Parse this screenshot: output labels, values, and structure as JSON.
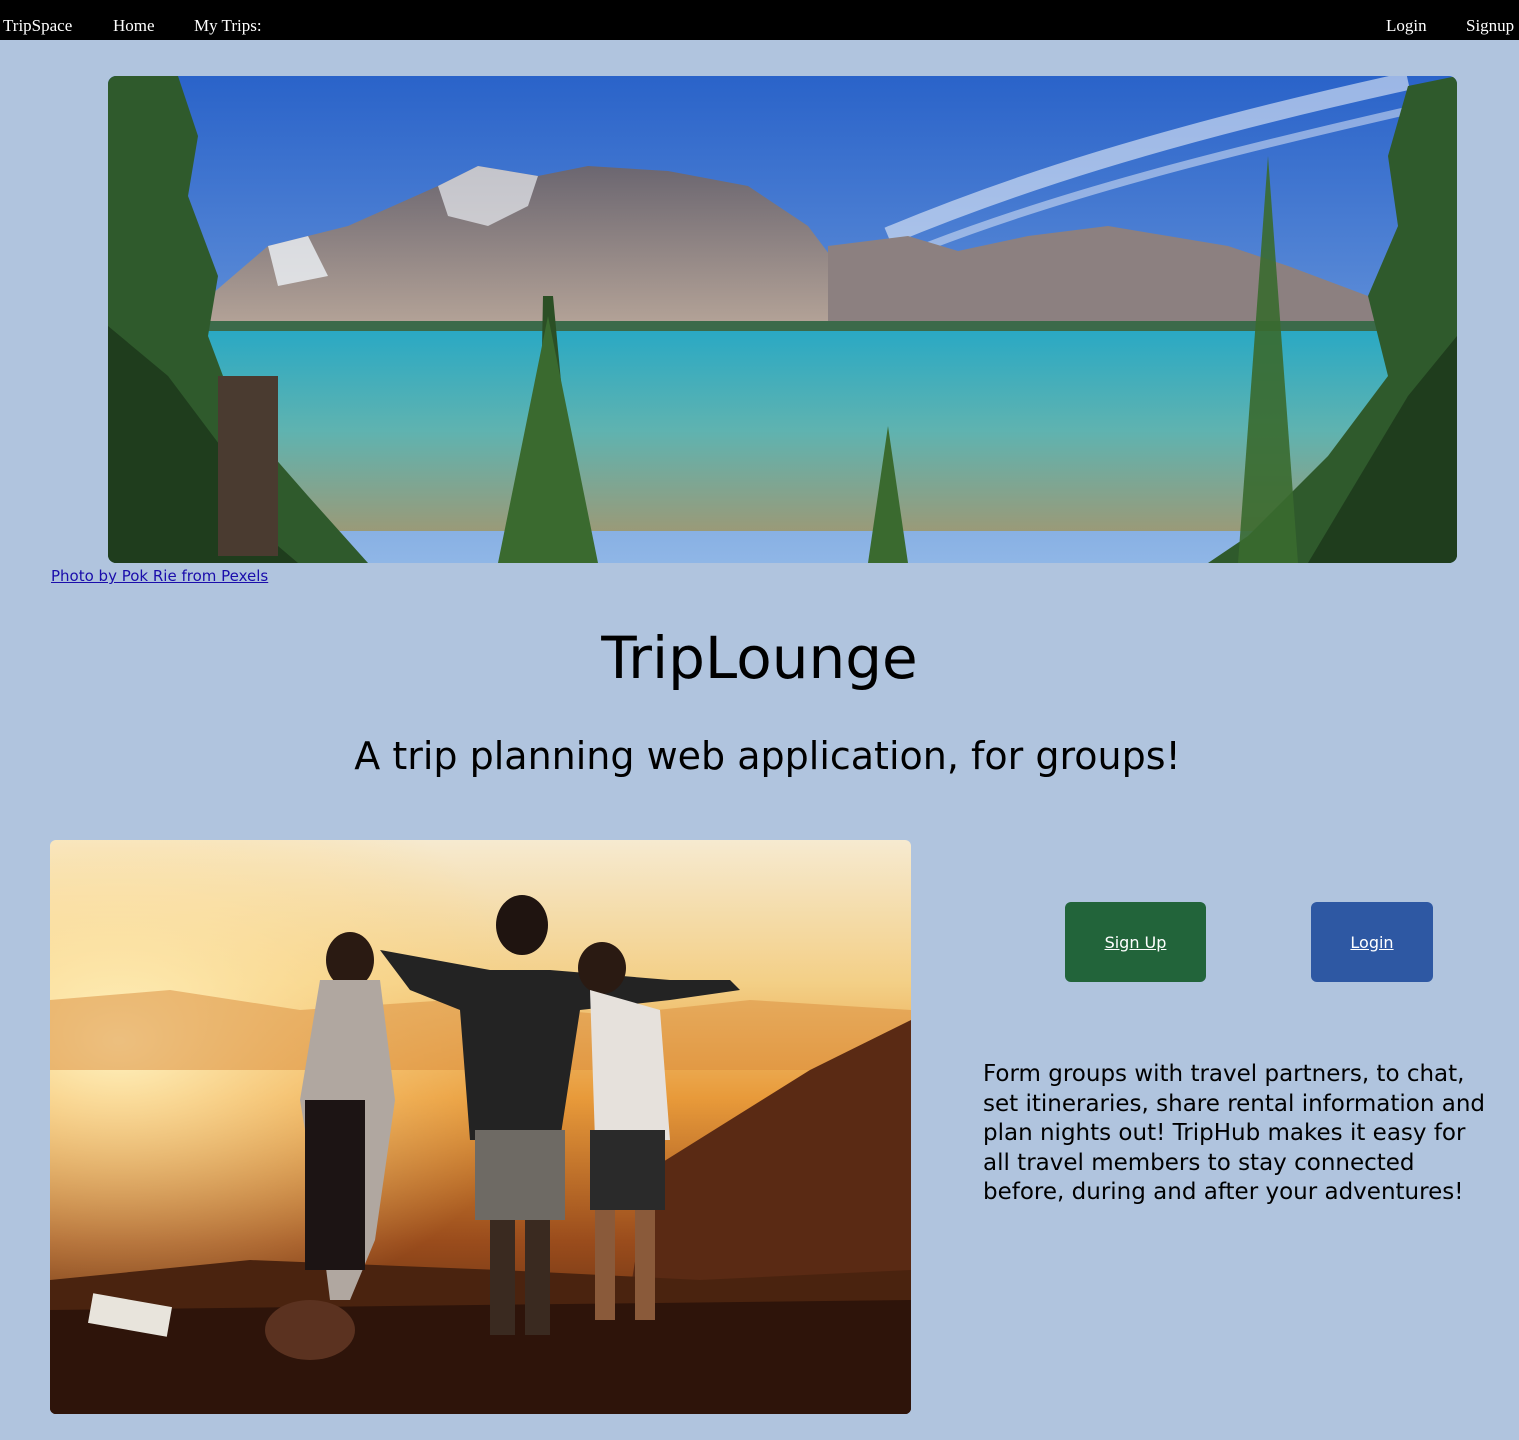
{
  "nav": {
    "brand": "TripSpace",
    "home": "Home",
    "my_trips": "My Trips:",
    "login": "Login",
    "signup": "Signup"
  },
  "hero": {
    "credit": "Photo by Pok Rie from Pexels"
  },
  "main": {
    "title": "TripLounge",
    "subtitle": "A trip planning web application, for groups!",
    "signup_button": "Sign Up",
    "login_button": "Login",
    "description": "Form groups with travel partners, to chat, set itineraries, share rental information and plan nights out! TripHub makes it easy for all travel members to stay connected before, during and after your adventures!"
  },
  "colors": {
    "page_bg": "#b0c4de",
    "nav_bg": "#000000",
    "signup_button": "#22643a",
    "login_button": "#2e58a3",
    "link": "#1a0dab"
  }
}
